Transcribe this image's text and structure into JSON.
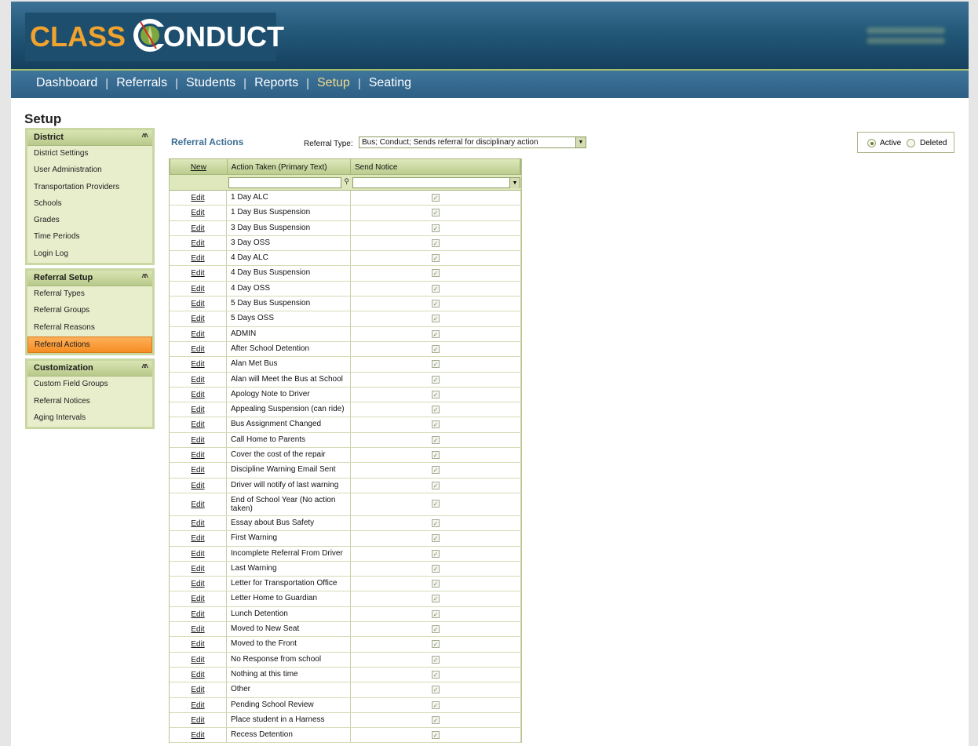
{
  "logo": {
    "part1": "CLASS",
    "part2": "ONDUCT"
  },
  "nav": {
    "items": [
      "Dashboard",
      "Referrals",
      "Students",
      "Reports",
      "Setup",
      "Seating"
    ],
    "separator": "|"
  },
  "page_title": "Setup",
  "sidebar": {
    "groups": [
      {
        "title": "District",
        "items": [
          "District Settings",
          "User Administration",
          "Transportation Providers",
          "Schools",
          "Grades",
          "Time Periods",
          "Login Log"
        ]
      },
      {
        "title": "Referral Setup",
        "items": [
          "Referral Types",
          "Referral Groups",
          "Referral Reasons",
          "Referral Actions"
        ]
      },
      {
        "title": "Customization",
        "items": [
          "Custom Field Groups",
          "Referral Notices",
          "Aging Intervals"
        ]
      }
    ],
    "chevron": "«"
  },
  "main": {
    "title": "Referral Actions",
    "referral_type_label": "Referral Type:",
    "referral_type_value": "Bus; Conduct; Sends referral for disciplinary action",
    "status": {
      "active": "Active",
      "deleted": "Deleted"
    }
  },
  "grid": {
    "columns": {
      "new": "New",
      "action": "Action Taken (Primary Text)",
      "notice": "Send Notice"
    },
    "edit_label": "Edit",
    "rows": [
      "1 Day ALC",
      "1 Day Bus Suspension",
      "3 Day Bus Suspension",
      "3 Day OSS",
      "4 Day ALC",
      "4 Day Bus Suspension",
      "4 Day OSS",
      "5 Day Bus Suspension",
      "5 Days OSS",
      "ADMIN",
      "After School Detention",
      "Alan Met Bus",
      "Alan will Meet the Bus at School",
      "Apology Note to Driver",
      "Appealing Suspension (can ride)",
      "Bus Assignment Changed",
      "Call Home to Parents",
      "Cover the cost of the repair",
      "Discipline Warning Email Sent",
      "Driver will notify of last warning",
      "End of School Year (No action taken)",
      "Essay about Bus Safety",
      "First Warning",
      "Incomplete Referral From Driver",
      "Last Warning",
      "Letter for Transportation Office",
      "Letter Home to Guardian",
      "Lunch Detention",
      "Moved to New Seat",
      "Moved to the Front",
      "No Response from school",
      "Nothing at this time",
      "Other",
      "Pending School Review",
      "Place student in a Harness",
      "Recess Detention"
    ]
  }
}
